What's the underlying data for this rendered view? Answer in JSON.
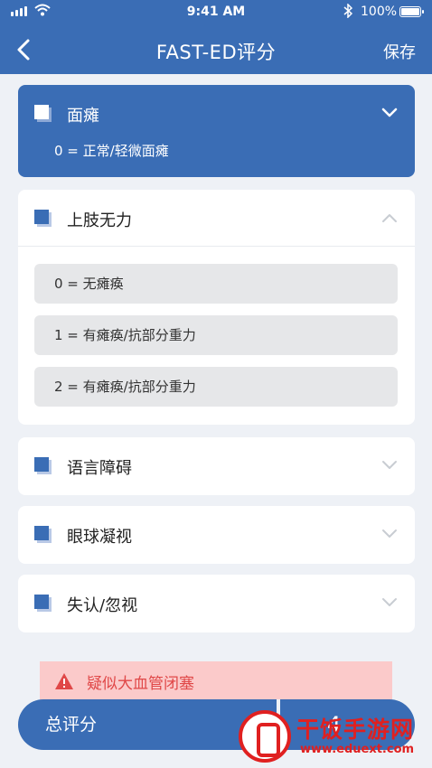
{
  "status": {
    "time": "9:41 AM",
    "battery": "100%"
  },
  "nav": {
    "title": "FAST-ED评分",
    "save_label": "保存"
  },
  "sections": [
    {
      "title": "面瘫",
      "subtitle": "0 = 正常/轻微面瘫",
      "state": "selected"
    },
    {
      "title": "上肢无力",
      "state": "expanded",
      "options": [
        "0 = 无瘫痪",
        "1 = 有瘫痪/抗部分重力",
        "2 = 有瘫痪/抗部分重力"
      ]
    },
    {
      "title": "语言障碍",
      "state": "collapsed"
    },
    {
      "title": "眼球凝视",
      "state": "collapsed"
    },
    {
      "title": "失认/忽视",
      "state": "collapsed"
    }
  ],
  "alert": {
    "text": "疑似大血管闭塞",
    "color": "#e04848"
  },
  "total": {
    "label": "总评分",
    "value": "4"
  },
  "watermark": {
    "name": "干饭手游网",
    "url": "www.eduext.com"
  },
  "colors": {
    "primary": "#3a6db5",
    "background": "#eef1f6",
    "alert_bg": "#fbcaca"
  }
}
